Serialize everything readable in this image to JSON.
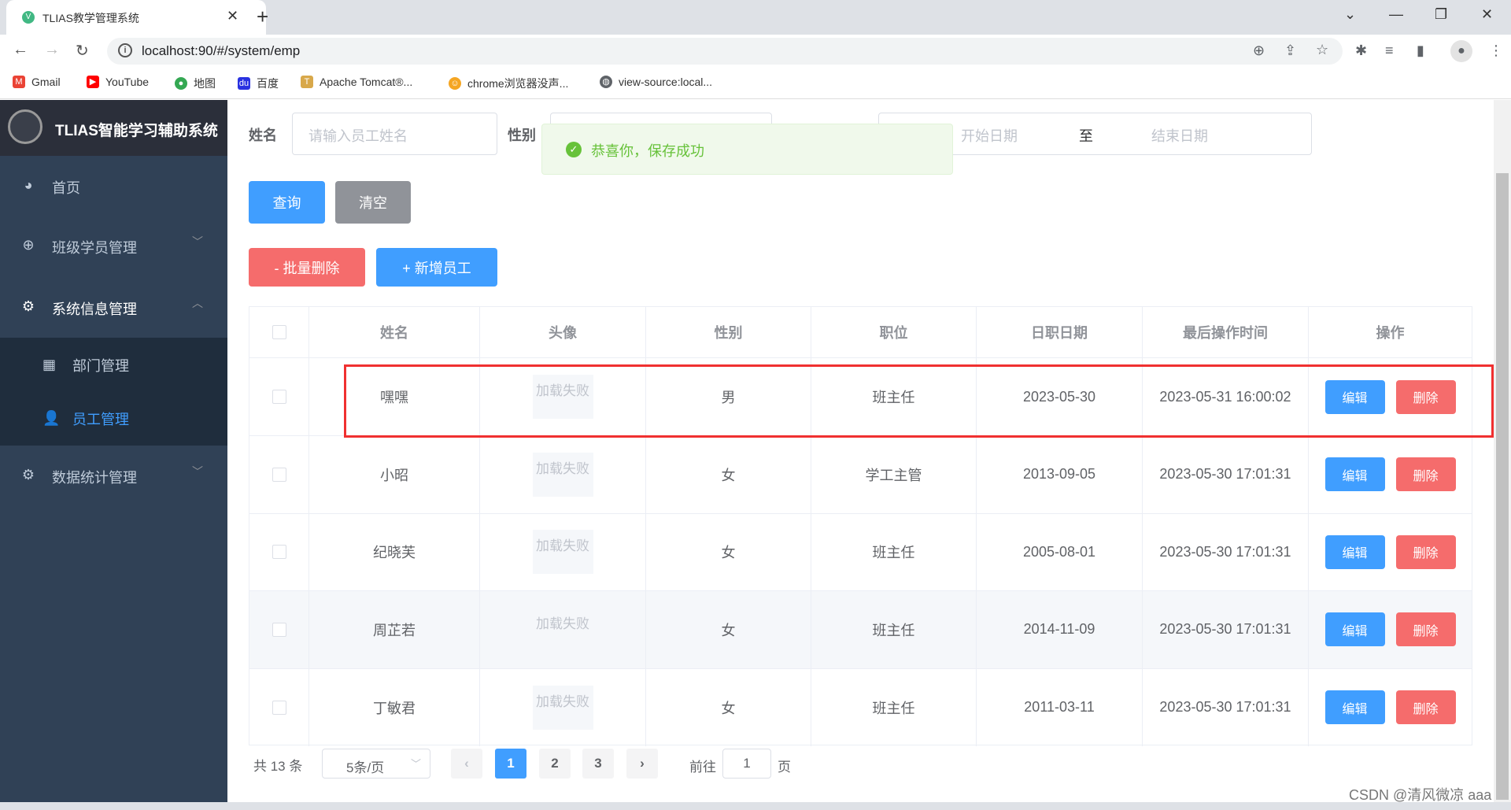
{
  "browser": {
    "tab_title": "TLIAS教学管理系统",
    "url": "localhost:90/#/system/emp",
    "bookmarks": [
      {
        "label": "Gmail",
        "icon": "gmail-icon",
        "color": "#ea4335"
      },
      {
        "label": "YouTube",
        "icon": "youtube-icon",
        "color": "#ff0000"
      },
      {
        "label": "地图",
        "icon": "maps-icon",
        "color": "#34a853"
      },
      {
        "label": "百度",
        "icon": "baidu-icon",
        "color": "#2932e1"
      },
      {
        "label": "Apache Tomcat®...",
        "icon": "tomcat-icon",
        "color": "#d8a84a"
      },
      {
        "label": "chrome浏览器没声...",
        "icon": "chrome-help-icon",
        "color": "#f5a623"
      },
      {
        "label": "view-source:local...",
        "icon": "globe-icon",
        "color": "#5f6368"
      }
    ]
  },
  "sidebar": {
    "logo_text": "TLIAS智能学习辅助系统",
    "items": [
      {
        "label": "首页",
        "icon": "dashboard-icon"
      },
      {
        "label": "班级学员管理",
        "icon": "class-icon"
      },
      {
        "label": "系统信息管理",
        "icon": "gear-icon"
      },
      {
        "label": "部门管理",
        "icon": "grid-icon"
      },
      {
        "label": "员工管理",
        "icon": "user-icon"
      },
      {
        "label": "数据统计管理",
        "icon": "gear-icon"
      }
    ]
  },
  "search": {
    "name_label": "姓名",
    "name_placeholder": "请输入员工姓名",
    "gender_label": "性别",
    "start_placeholder": "开始日期",
    "range_sep": "至",
    "end_placeholder": "结束日期",
    "query_label": "查询",
    "clear_label": "清空"
  },
  "toast": {
    "message": "恭喜你，保存成功",
    "color": "#67c23a"
  },
  "actions": {
    "batch_delete_label": "- 批量删除",
    "add_label": "+ 新增员工"
  },
  "table": {
    "headers": [
      "姓名",
      "头像",
      "性别",
      "职位",
      "日职日期",
      "最后操作时间",
      "操作"
    ],
    "avatar_fail_text": "加载失败",
    "edit_label": "编辑",
    "delete_label": "删除",
    "rows": [
      {
        "name": "嘿嘿",
        "gender": "男",
        "job": "班主任",
        "entry_date": "2023-05-30",
        "update_time": "2023-05-31 16:00:02"
      },
      {
        "name": "小昭",
        "gender": "女",
        "job": "学工主管",
        "entry_date": "2013-09-05",
        "update_time": "2023-05-30 17:01:31"
      },
      {
        "name": "纪晓芙",
        "gender": "女",
        "job": "班主任",
        "entry_date": "2005-08-01",
        "update_time": "2023-05-30 17:01:31"
      },
      {
        "name": "周芷若",
        "gender": "女",
        "job": "班主任",
        "entry_date": "2014-11-09",
        "update_time": "2023-05-30 17:01:31"
      },
      {
        "name": "丁敏君",
        "gender": "女",
        "job": "班主任",
        "entry_date": "2011-03-11",
        "update_time": "2023-05-30 17:01:31"
      }
    ]
  },
  "pagination": {
    "total_text": "共 13 条",
    "page_size": "5条/页",
    "pages": [
      "1",
      "2",
      "3"
    ],
    "current": "1",
    "goto_label": "前往",
    "goto_value": "1",
    "page_suffix": "页"
  },
  "watermark": "CSDN @清风微凉 aaa",
  "colors": {
    "primary": "#409eff",
    "danger": "#f56c6c",
    "info": "#909399",
    "sidebar": "#304156",
    "highlight_box": "#f03030"
  }
}
